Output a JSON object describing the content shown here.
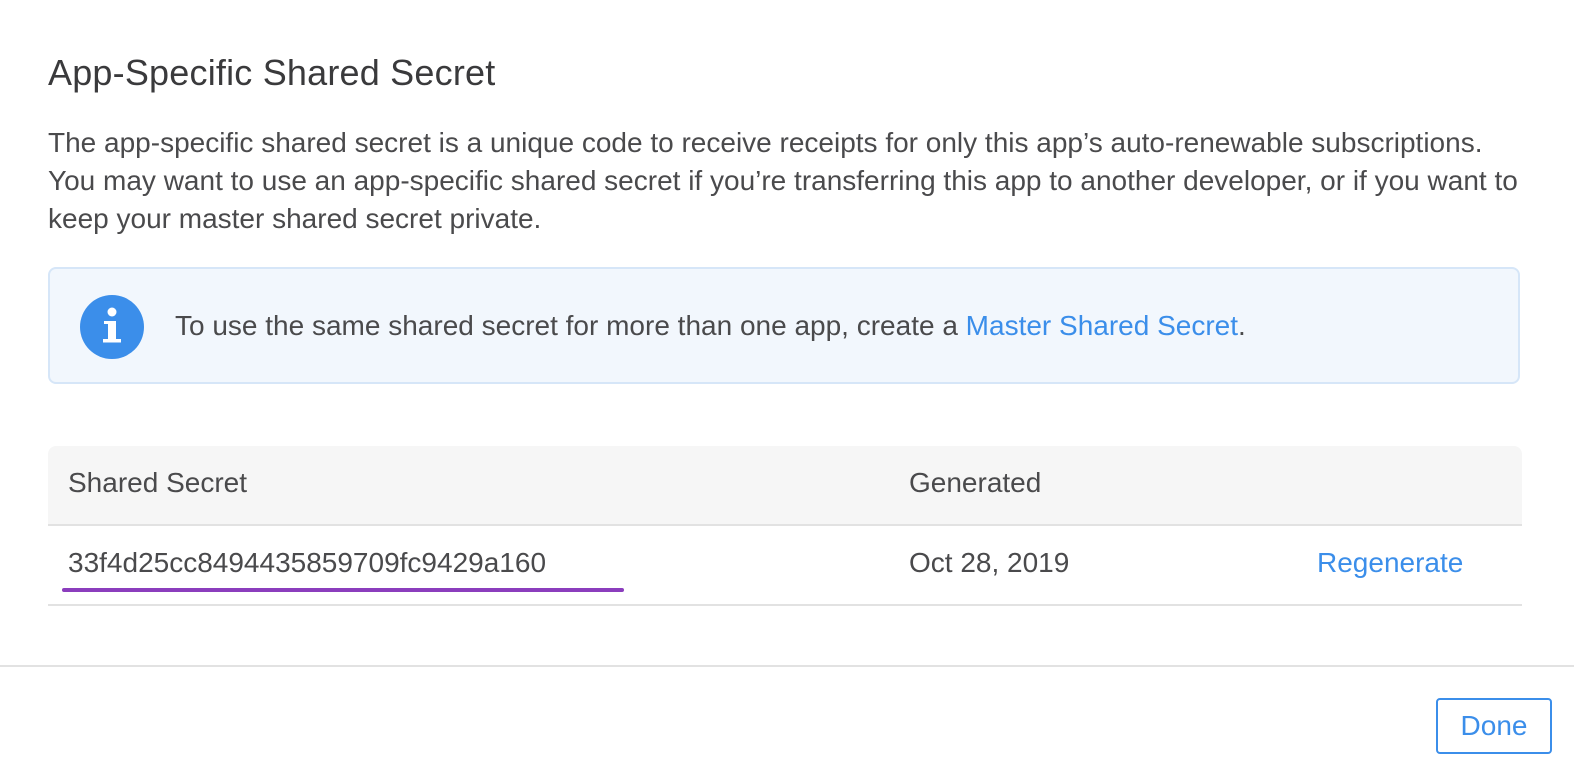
{
  "dialog": {
    "title": "App-Specific Shared Secret",
    "description": "The app-specific shared secret is a unique code to receive receipts for only this app’s auto-renewable subscriptions. You may want to use an app-specific shared secret if you’re transferring this app to another developer, or if you want to keep your master shared secret private."
  },
  "info": {
    "icon": "info-icon",
    "text_before": "To use the same shared secret for more than one app, create a ",
    "link_label": "Master Shared Secret",
    "text_after": "."
  },
  "table": {
    "columns": [
      "Shared Secret",
      "Generated"
    ],
    "rows": [
      {
        "secret": "33f4d25cc8494435859709fc9429a160",
        "generated": "Oct 28, 2019",
        "action_label": "Regenerate"
      }
    ]
  },
  "footer": {
    "done_label": "Done"
  },
  "colors": {
    "accent": "#3b8eea",
    "highlight_underline": "#8b3dbd",
    "info_background": "#f2f7fd"
  }
}
